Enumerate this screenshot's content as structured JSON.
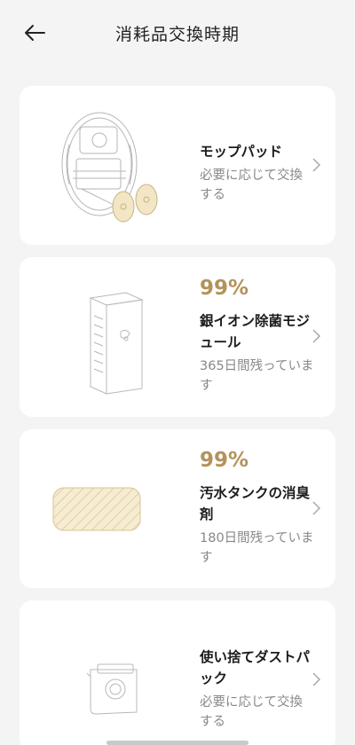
{
  "header": {
    "title": "消耗品交換時期"
  },
  "cards": [
    {
      "percent": "",
      "name": "モップパッド",
      "status": "必要に応じて交換する",
      "image": "robot-vacuum-with-mop-pads-image"
    },
    {
      "percent": "99%",
      "name": "銀イオン除菌モジュール",
      "status": "365日間残っています",
      "image": "silver-ion-module-image"
    },
    {
      "percent": "99%",
      "name": "汚水タンクの消臭剤",
      "status": "180日間残っています",
      "image": "deodorizer-pad-image"
    },
    {
      "percent": "",
      "name": "使い捨てダストパック",
      "status": "必要に応じて交換する",
      "image": "dust-bag-image"
    }
  ],
  "colors": {
    "accent": "#b3935b",
    "background": "#f4f4f4",
    "card": "#ffffff"
  }
}
